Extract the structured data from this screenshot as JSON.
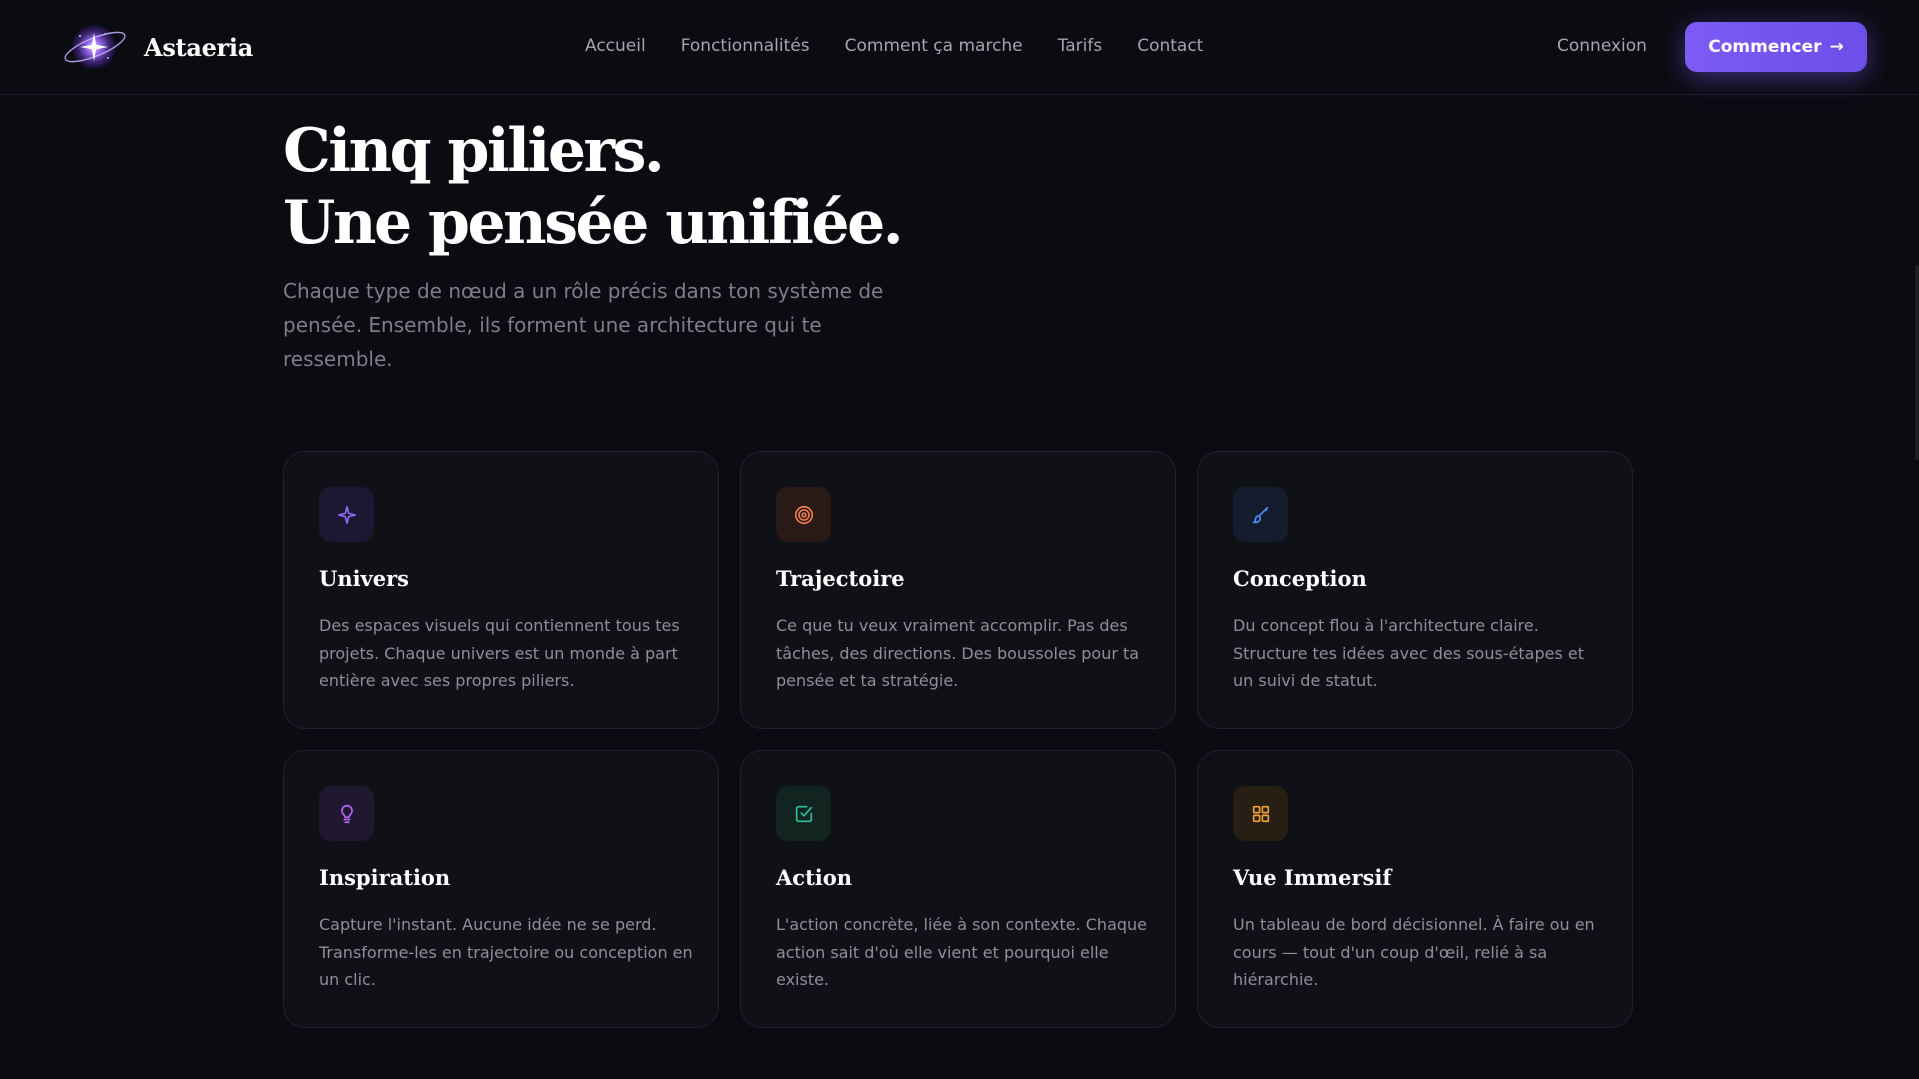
{
  "header": {
    "brand": "Astaeria",
    "nav": [
      "Accueil",
      "Fonctionnalités",
      "Comment ça marche",
      "Tarifs",
      "Contact"
    ],
    "login": "Connexion",
    "cta": "Commencer",
    "cta_arrow": "→"
  },
  "hero": {
    "title_line1": "Cinq piliers.",
    "title_line2": "Une pensée unifiée.",
    "subtitle": "Chaque type de nœud a un rôle précis dans ton système de pensée. Ensemble, ils forment une architecture qui te ressemble."
  },
  "cards": [
    {
      "title": "Univers",
      "description": "Des espaces visuels qui contiennent tous tes projets. Chaque univers est un monde à part entière avec ses propres piliers.",
      "icon": "sparkle-icon",
      "color": "#8b6cf6"
    },
    {
      "title": "Trajectoire",
      "description": "Ce que tu veux vraiment accomplir. Pas des tâches, des directions. Des boussoles pour ta pensée et ta stratégie.",
      "icon": "target-icon",
      "color": "#f07a4f"
    },
    {
      "title": "Conception",
      "description": "Du concept flou à l'architecture claire. Structure tes idées avec des sous-étapes et un suivi de statut.",
      "icon": "brush-icon",
      "color": "#4f8ef7"
    },
    {
      "title": "Inspiration",
      "description": "Capture l'instant. Aucune idée ne se perd. Transforme-les en trajectoire ou conception en un clic.",
      "icon": "lightbulb-icon",
      "color": "#b467f5"
    },
    {
      "title": "Action",
      "description": "L'action concrète, liée à son contexte. Chaque action sait d'où elle vient et pourquoi elle existe.",
      "icon": "checkbox-icon",
      "color": "#2fc29a"
    },
    {
      "title": "Vue Immersif",
      "description": "Un tableau de bord décisionnel. À faire ou en cours — tout d'un coup d'œil, relié à sa hiérarchie.",
      "icon": "grid-icon",
      "color": "#f0a23c"
    }
  ]
}
